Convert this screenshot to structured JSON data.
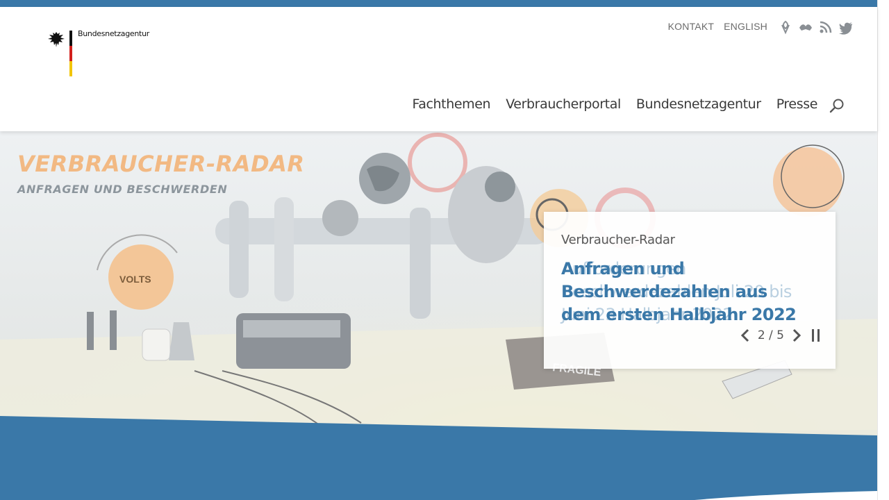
{
  "header": {
    "logo_text": "Bundesnetzagentur",
    "meta_nav": [
      "KONTAKT",
      "ENGLISH"
    ],
    "social_icons": [
      "leichte-sprache-icon",
      "gebaerdensprache-icon",
      "rss-icon",
      "twitter-icon"
    ],
    "main_nav": [
      "Fachthemen",
      "Verbraucherportal",
      "Bundesnetzagentur",
      "Presse"
    ]
  },
  "hero": {
    "title": "VERBRAUCHER-RADAR",
    "subtitle": "ANFRAGEN UND BESCHWERDEN",
    "teaser": {
      "label": "Verbraucher-Radar",
      "label_ghost": "Verbraucher-Radar",
      "headline": "Anfragen und Beschwerdezahlen aus dem ersten Halbjahr 2022",
      "headline_ghost": "Aufforderungen Beschwerdezahlen Juli 20 bis Juni 23 Halbjahr 2022"
    },
    "slider": {
      "counter": "2 / 5"
    }
  },
  "colors": {
    "brand_blue": "#3a78a8",
    "radar_orange": "#f2b983",
    "subtitle_grey": "#8c959c"
  }
}
